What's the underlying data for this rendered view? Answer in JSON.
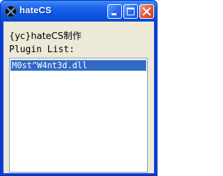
{
  "window": {
    "title": "hateCS",
    "controls": {
      "minimize": "minimize",
      "maximize": "maximize",
      "close": "close"
    }
  },
  "content": {
    "caption": "{yc}hateCS制作",
    "list_label": "Plugin List:",
    "plugins": [
      "M0st^W4nt3d.dll"
    ],
    "selected_index": 0
  },
  "colors": {
    "titlebar": "#0c54e2",
    "client_bg": "#ece9d8",
    "selection": "#316ac5",
    "close_button": "#e0563a"
  }
}
